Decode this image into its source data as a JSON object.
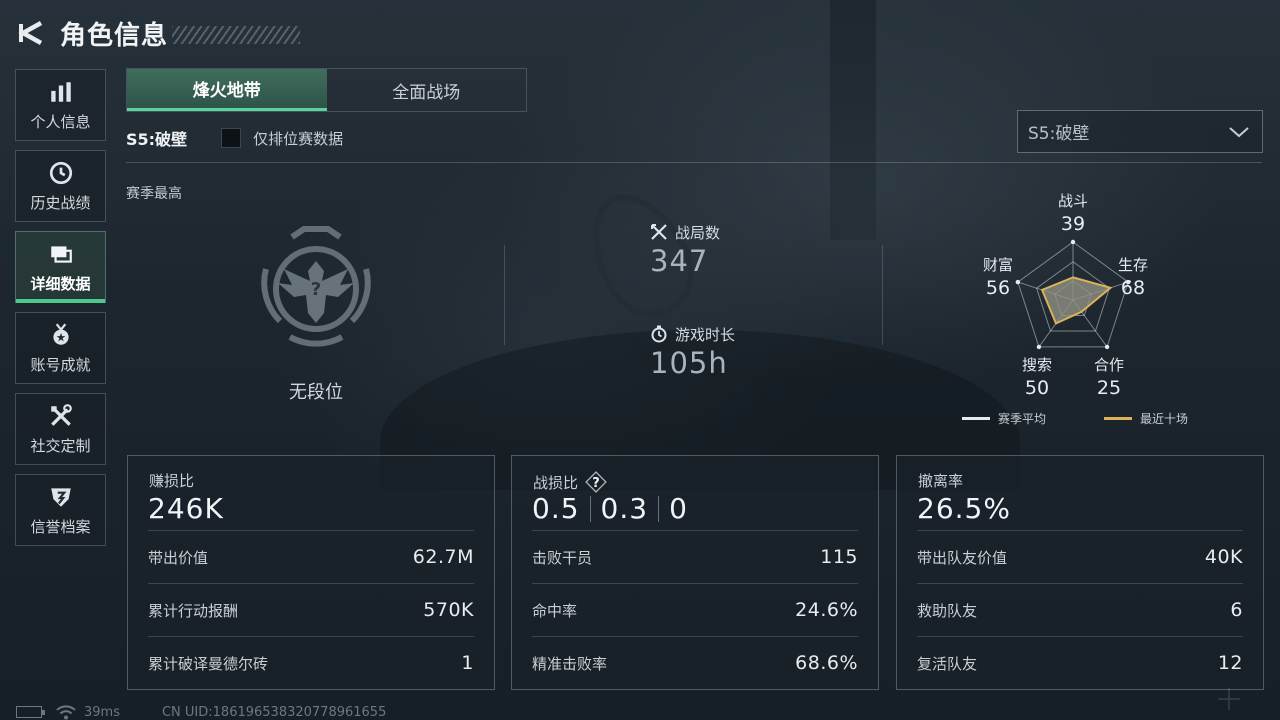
{
  "header": {
    "title": "角色信息"
  },
  "sidebar": {
    "items": [
      {
        "label": "个人信息",
        "icon": "bar-chart-icon"
      },
      {
        "label": "历史战绩",
        "icon": "clock-history-icon"
      },
      {
        "label": "详细数据",
        "icon": "folder-stack-icon",
        "active": true
      },
      {
        "label": "账号成就",
        "icon": "medal-icon"
      },
      {
        "label": "社交定制",
        "icon": "crossed-tools-icon"
      },
      {
        "label": "信誉档案",
        "icon": "shield-badge-icon"
      }
    ]
  },
  "tabs": [
    {
      "label": "烽火地带",
      "active": true
    },
    {
      "label": "全面战场",
      "active": false
    }
  ],
  "season": {
    "label": "S5:破壁",
    "rank_only_label": "仅排位赛数据",
    "rank_only_checked": false,
    "select_value": "S5:破壁"
  },
  "overview": {
    "season_best_label": "赛季最高",
    "rank_name": "无段位",
    "matches_label": "战局数",
    "matches_value": "347",
    "playtime_label": "游戏时长",
    "playtime_value": "105h"
  },
  "radar": {
    "axes": [
      {
        "label": "战斗",
        "value": 39
      },
      {
        "label": "生存",
        "value": 68
      },
      {
        "label": "合作",
        "value": 25
      },
      {
        "label": "搜索",
        "value": 50
      },
      {
        "label": "财富",
        "value": 56
      }
    ],
    "legend": [
      {
        "label": "赛季平均",
        "color": "#e6eaee"
      },
      {
        "label": "最近十场",
        "color": "#d9b25a"
      }
    ],
    "colors": {
      "season_avg_fill": "#7d8790",
      "recent_line": "#d9b25a"
    }
  },
  "panels": {
    "profit": {
      "title": "赚损比",
      "main": "246K",
      "rows": [
        {
          "label": "带出价值",
          "value": "62.7M"
        },
        {
          "label": "累计行动报酬",
          "value": "570K"
        },
        {
          "label": "累计破译曼德尔砖",
          "value": "1"
        }
      ]
    },
    "combat": {
      "title": "战损比",
      "main_values": [
        "0.5",
        "0.3",
        "0"
      ],
      "rows": [
        {
          "label": "击败干员",
          "value": "115"
        },
        {
          "label": "命中率",
          "value": "24.6%"
        },
        {
          "label": "精准击败率",
          "value": "68.6%"
        }
      ]
    },
    "extract": {
      "title": "撤离率",
      "main": "26.5%",
      "rows": [
        {
          "label": "带出队友价值",
          "value": "40K"
        },
        {
          "label": "救助队友",
          "value": "6"
        },
        {
          "label": "复活队友",
          "value": "12"
        }
      ]
    }
  },
  "footer": {
    "ping": "39ms",
    "uid": "CN UID:186196538320778961655"
  },
  "colors": {
    "accent_green": "#57d59a",
    "accent_gold": "#d9b25a"
  }
}
